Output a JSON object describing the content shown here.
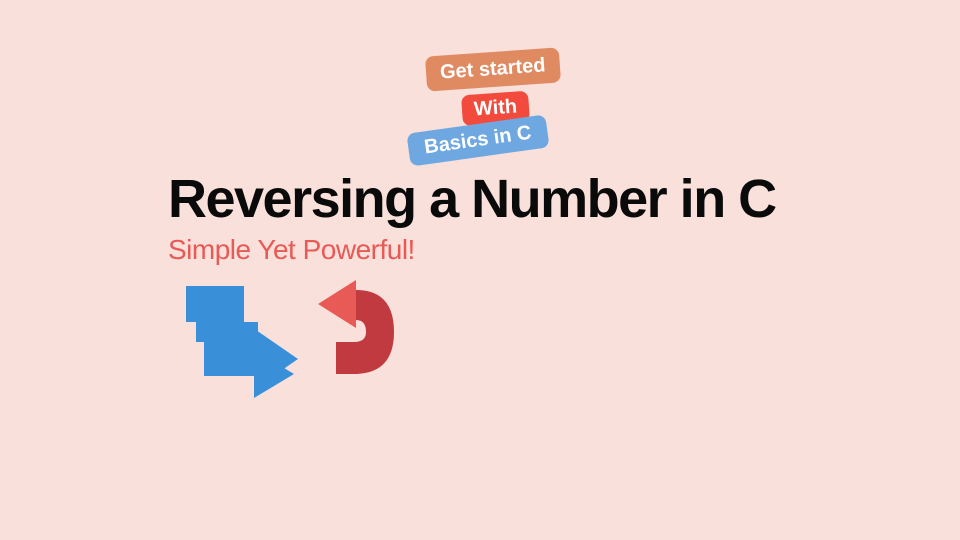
{
  "badges": {
    "get_started": "Get started",
    "with": "With",
    "basics": "Basics in C"
  },
  "title": "Reversing a Number in C",
  "subtitle": "Simple Yet Powerful!",
  "colors": {
    "background": "#f9e0db",
    "badge_orange": "#e08a62",
    "badge_red": "#f24a3d",
    "badge_blue": "#6fa8e0",
    "title": "#0a0a0a",
    "subtitle": "#e85a55",
    "arrow_blue": "#3a8fd9",
    "arrow_red_light": "#e85a55",
    "arrow_red_dark": "#c13a3f"
  }
}
